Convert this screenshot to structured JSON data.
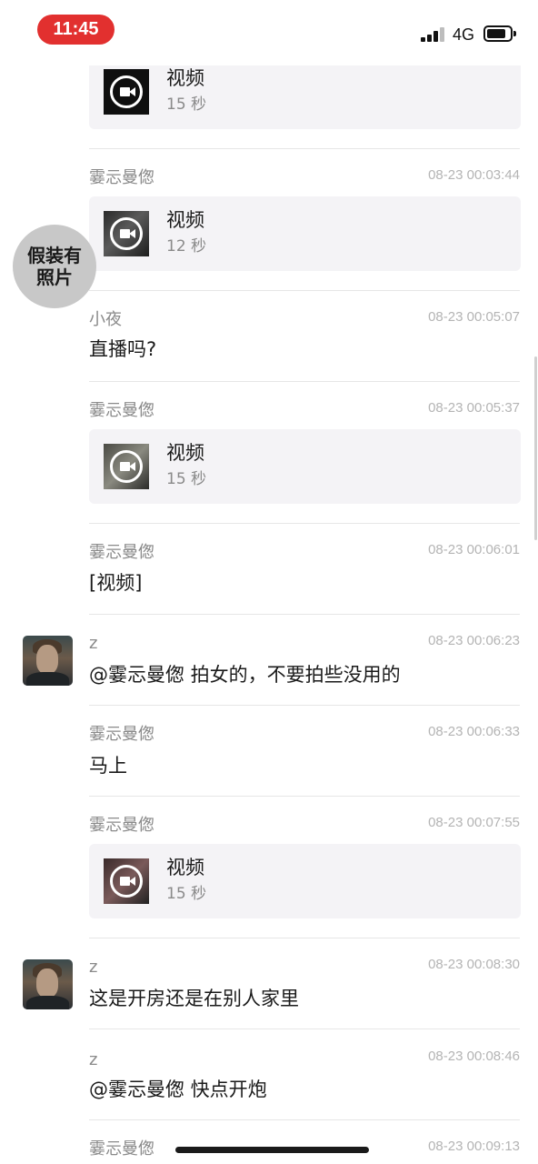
{
  "status_bar": {
    "time": "11:45",
    "network": "4G"
  },
  "messages": [
    {
      "type": "video",
      "title": "视频",
      "duration": "15 秒"
    },
    {
      "sender": "霎忈曼偬",
      "timestamp": "08-23 00:03:44",
      "type": "video",
      "title": "视频",
      "duration": "12 秒"
    },
    {
      "sender": "小夜",
      "timestamp": "08-23 00:05:07",
      "type": "text",
      "text": "直播吗?",
      "avatar_text": "假装有照片"
    },
    {
      "sender": "霎忈曼偬",
      "timestamp": "08-23 00:05:37",
      "type": "video",
      "title": "视频",
      "duration": "15 秒"
    },
    {
      "sender": "霎忈曼偬",
      "timestamp": "08-23 00:06:01",
      "type": "text",
      "text": "[视频]"
    },
    {
      "sender": "z",
      "timestamp": "08-23 00:06:23",
      "type": "text",
      "text": "@霎忈曼偬 拍女的，不要拍些没用的"
    },
    {
      "sender": "霎忈曼偬",
      "timestamp": "08-23 00:06:33",
      "type": "text",
      "text": "马上"
    },
    {
      "sender": "霎忈曼偬",
      "timestamp": "08-23 00:07:55",
      "type": "video",
      "title": "视频",
      "duration": "15 秒"
    },
    {
      "sender": "z",
      "timestamp": "08-23 00:08:30",
      "type": "text",
      "text": "这是开房还是在别人家里"
    },
    {
      "sender": "z",
      "timestamp": "08-23 00:08:46",
      "type": "text",
      "text": "@霎忈曼偬 快点开炮"
    },
    {
      "sender": "霎忈曼偬",
      "timestamp": "08-23 00:09:13",
      "type": "partial"
    }
  ]
}
